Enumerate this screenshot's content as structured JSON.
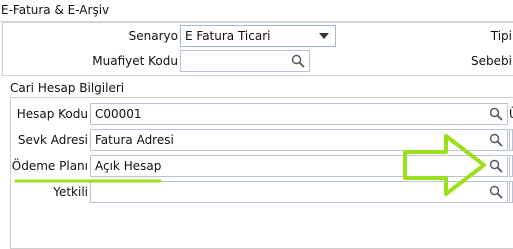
{
  "section": {
    "title": "E-Fatura & E-Arşiv"
  },
  "senaryo": {
    "label": "Senaryo",
    "value": "E Fatura Ticari"
  },
  "tipi": {
    "label": "Tipi"
  },
  "muafiyet": {
    "label": "Muafiyet Kodu",
    "value": ""
  },
  "sebebi": {
    "label": "Sebebi"
  },
  "cari": {
    "title": "Cari Hesap Bilgileri",
    "hesap_kodu": {
      "label": "Hesap Kodu",
      "value": "C00001"
    },
    "sevk_adresi": {
      "label": "Sevk Adresi",
      "value": "Fatura Adresi"
    },
    "odeme_plani": {
      "label": "Ödeme Planı",
      "value": "Açık Hesap"
    },
    "yetkili": {
      "label": "Yetkili",
      "value": ""
    }
  },
  "right_edge_text": "Ü",
  "colors": {
    "annotation": "#9be01a",
    "field_border": "#b8c4d4",
    "separator": "#d4d4d4"
  },
  "icons": {
    "lookup": "magnifier-icon",
    "dropdown": "chevron-down-icon",
    "annotation_arrow": "arrow-right-icon"
  }
}
